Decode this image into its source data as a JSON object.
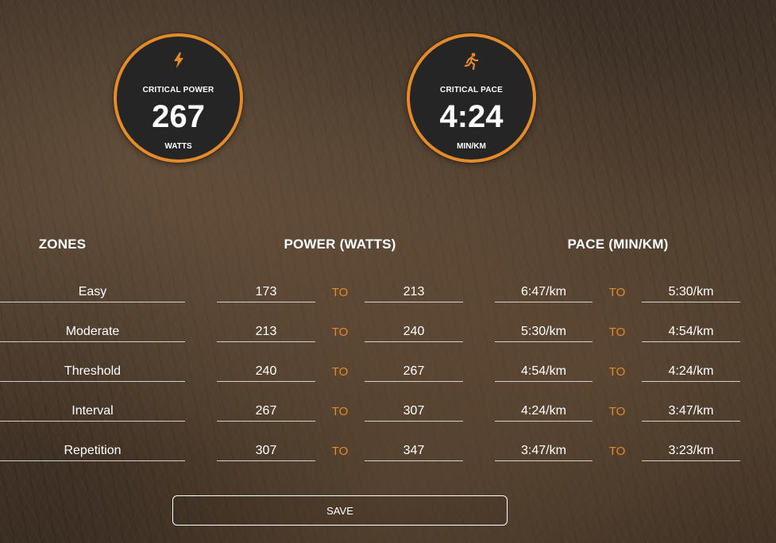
{
  "colors": {
    "accent": "#e38a2a",
    "gauge_bg": "#252525",
    "text": "#ffffff"
  },
  "critical_power": {
    "icon": "lightning-bolt-icon",
    "title": "CRITICAL POWER",
    "value": "267",
    "unit": "WATTS"
  },
  "critical_pace": {
    "icon": "running-person-icon",
    "title": "CRITICAL PACE",
    "value": "4:24",
    "unit": "MIN/KM"
  },
  "headers": {
    "zones": "ZONES",
    "power": "POWER (WATTS)",
    "pace": "PACE (MIN/KM)"
  },
  "to_label": "TO",
  "zones": [
    {
      "name": "Easy",
      "power_from": "173",
      "power_to": "213",
      "pace_from": "6:47/km",
      "pace_to": "5:30/km"
    },
    {
      "name": "Moderate",
      "power_from": "213",
      "power_to": "240",
      "pace_from": "5:30/km",
      "pace_to": "4:54/km"
    },
    {
      "name": "Threshold",
      "power_from": "240",
      "power_to": "267",
      "pace_from": "4:54/km",
      "pace_to": "4:24/km"
    },
    {
      "name": "Interval",
      "power_from": "267",
      "power_to": "307",
      "pace_from": "4:24/km",
      "pace_to": "3:47/km"
    },
    {
      "name": "Repetition",
      "power_from": "307",
      "power_to": "347",
      "pace_from": "3:47/km",
      "pace_to": "3:23/km"
    }
  ],
  "save_label": "SAVE"
}
